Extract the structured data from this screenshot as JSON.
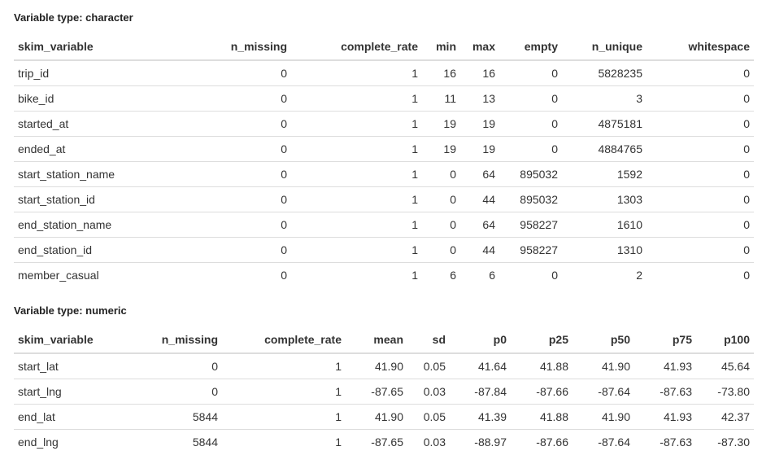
{
  "character_section": {
    "title": "Variable type: character",
    "columns": [
      "skim_variable",
      "n_missing",
      "complete_rate",
      "min",
      "max",
      "empty",
      "n_unique",
      "whitespace"
    ],
    "rows": [
      [
        "trip_id",
        "0",
        "1",
        "16",
        "16",
        "0",
        "5828235",
        "0"
      ],
      [
        "bike_id",
        "0",
        "1",
        "11",
        "13",
        "0",
        "3",
        "0"
      ],
      [
        "started_at",
        "0",
        "1",
        "19",
        "19",
        "0",
        "4875181",
        "0"
      ],
      [
        "ended_at",
        "0",
        "1",
        "19",
        "19",
        "0",
        "4884765",
        "0"
      ],
      [
        "start_station_name",
        "0",
        "1",
        "0",
        "64",
        "895032",
        "1592",
        "0"
      ],
      [
        "start_station_id",
        "0",
        "1",
        "0",
        "44",
        "895032",
        "1303",
        "0"
      ],
      [
        "end_station_name",
        "0",
        "1",
        "0",
        "64",
        "958227",
        "1610",
        "0"
      ],
      [
        "end_station_id",
        "0",
        "1",
        "0",
        "44",
        "958227",
        "1310",
        "0"
      ],
      [
        "member_casual",
        "0",
        "1",
        "6",
        "6",
        "0",
        "2",
        "0"
      ]
    ]
  },
  "numeric_section": {
    "title": "Variable type: numeric",
    "columns": [
      "skim_variable",
      "n_missing",
      "complete_rate",
      "mean",
      "sd",
      "p0",
      "p25",
      "p50",
      "p75",
      "p100"
    ],
    "rows": [
      [
        "start_lat",
        "0",
        "1",
        "41.90",
        "0.05",
        "41.64",
        "41.88",
        "41.90",
        "41.93",
        "45.64"
      ],
      [
        "start_lng",
        "0",
        "1",
        "-87.65",
        "0.03",
        "-87.84",
        "-87.66",
        "-87.64",
        "-87.63",
        "-73.80"
      ],
      [
        "end_lat",
        "5844",
        "1",
        "41.90",
        "0.05",
        "41.39",
        "41.88",
        "41.90",
        "41.93",
        "42.37"
      ],
      [
        "end_lng",
        "5844",
        "1",
        "-87.65",
        "0.03",
        "-88.97",
        "-87.66",
        "-87.64",
        "-87.63",
        "-87.30"
      ]
    ]
  }
}
